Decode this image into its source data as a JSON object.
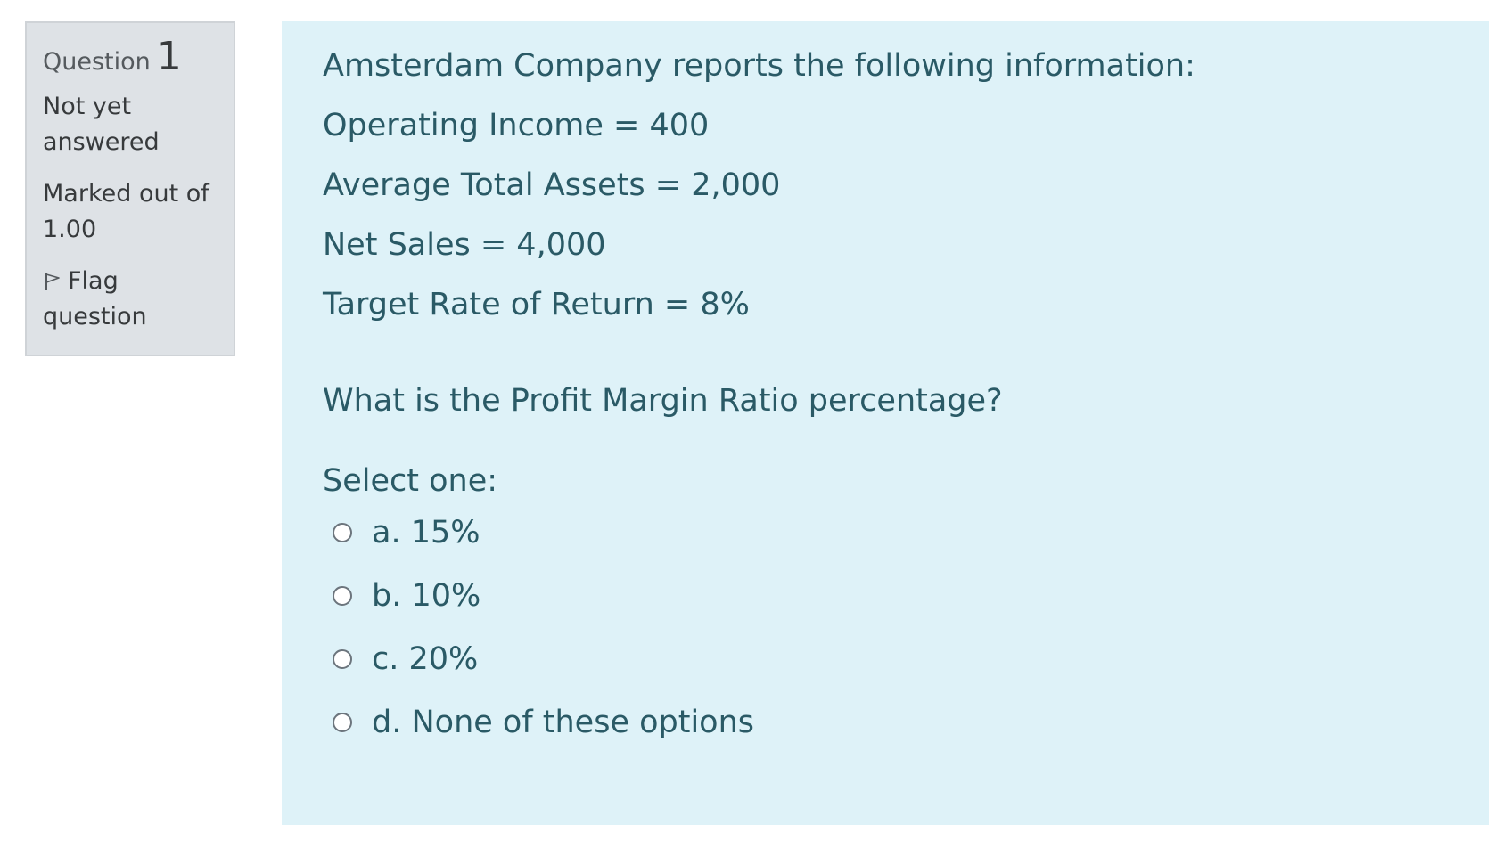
{
  "info": {
    "question_label": "Question",
    "question_number": "1",
    "state": "Not yet answered",
    "grade": "Marked out of 1.00",
    "flag_label": "Flag question"
  },
  "question": {
    "intro": "Amsterdam Company reports the following information:",
    "facts": [
      "Operating Income = 400",
      "Average Total Assets = 2,000",
      "Net Sales = 4,000",
      "Target Rate of Return = 8%"
    ],
    "text": "What is the Profit Margin Ratio percentage?"
  },
  "answer": {
    "prompt": "Select one:",
    "options": [
      {
        "label": "a. 15%"
      },
      {
        "label": "b. 10%"
      },
      {
        "label": "c. 20%"
      },
      {
        "label": "d. None of these options"
      }
    ]
  },
  "colors": {
    "info_bg": "#dee2e6",
    "content_bg": "#def2f8",
    "text_accent": "#2a5a66"
  },
  "icons": {
    "flag": "flag-icon",
    "radio": "radio-button"
  }
}
